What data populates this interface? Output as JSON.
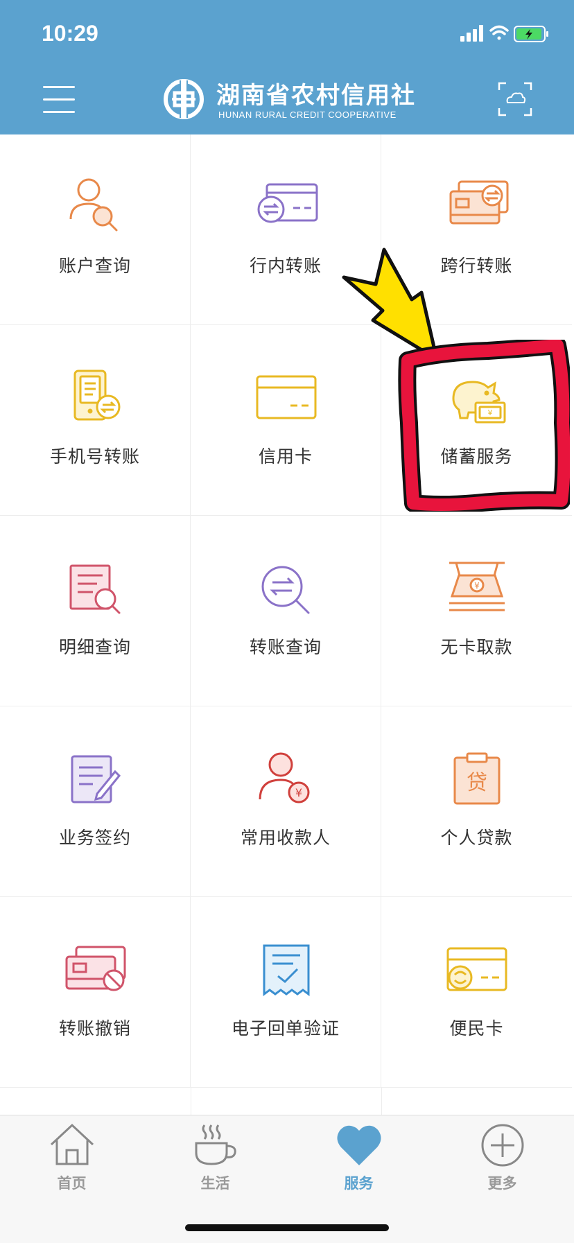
{
  "status_bar": {
    "time": "10:29"
  },
  "header": {
    "title": "湖南省农村信用社",
    "subtitle": "HUNAN RURAL CREDIT COOPERATIVE",
    "bg_color": "#5ba2cf"
  },
  "services": [
    {
      "label": "账户查询",
      "icon": "account-search-icon"
    },
    {
      "label": "行内转账",
      "icon": "internal-transfer-icon"
    },
    {
      "label": "跨行转账",
      "icon": "interbank-transfer-icon"
    },
    {
      "label": "手机号转账",
      "icon": "phone-transfer-icon"
    },
    {
      "label": "信用卡",
      "icon": "credit-card-icon"
    },
    {
      "label": "储蓄服务",
      "icon": "piggy-bank-icon"
    },
    {
      "label": "明细查询",
      "icon": "detail-search-icon"
    },
    {
      "label": "转账查询",
      "icon": "transfer-search-icon"
    },
    {
      "label": "无卡取款",
      "icon": "cardless-withdraw-icon"
    },
    {
      "label": "业务签约",
      "icon": "contract-sign-icon"
    },
    {
      "label": "常用收款人",
      "icon": "payee-icon"
    },
    {
      "label": "个人贷款",
      "icon": "loan-icon"
    },
    {
      "label": "转账撤销",
      "icon": "transfer-cancel-icon"
    },
    {
      "label": "电子回单验证",
      "icon": "e-receipt-icon"
    },
    {
      "label": "便民卡",
      "icon": "convenience-card-icon"
    }
  ],
  "highlight": {
    "target": "储蓄服务",
    "border_color": "#e8143c",
    "arrow_color": "#ffe000"
  },
  "tabbar": {
    "tabs": [
      {
        "label": "首页",
        "icon": "home-icon",
        "active": false
      },
      {
        "label": "生活",
        "icon": "coffee-cup-icon",
        "active": false
      },
      {
        "label": "服务",
        "icon": "heart-icon",
        "active": true
      },
      {
        "label": "更多",
        "icon": "plus-circle-icon",
        "active": false
      }
    ],
    "active_color": "#5ba2cf"
  }
}
